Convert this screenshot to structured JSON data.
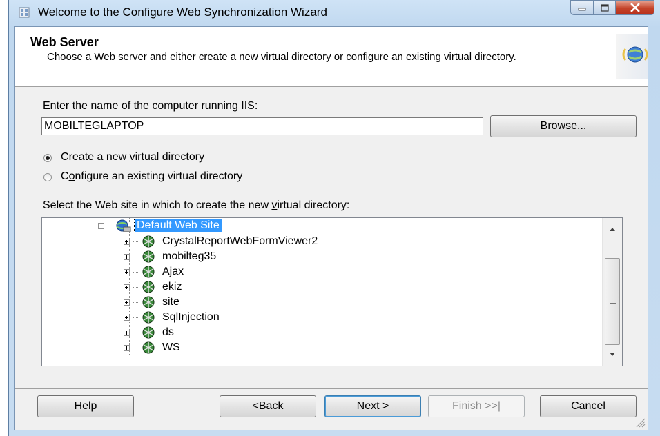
{
  "window": {
    "title": "Welcome to the Configure Web Synchronization Wizard"
  },
  "header": {
    "title": "Web Server",
    "description": "Choose a Web server and either create a new virtual directory or configure an existing virtual directory."
  },
  "computer": {
    "label_pre": "",
    "label_accel": "E",
    "label_post": "nter the name of the computer running IIS:",
    "value": "MOBILTEGLAPTOP",
    "browse_label": "Browse..."
  },
  "options": {
    "create": {
      "accel": "C",
      "rest": "reate a new virtual directory",
      "selected": true
    },
    "configure": {
      "pre": "C",
      "accel": "o",
      "rest": "nfigure an existing virtual directory",
      "selected": false
    }
  },
  "site_select": {
    "label_pre": "Select the Web site in which to create the new ",
    "label_accel": "v",
    "label_post": "irtual directory:"
  },
  "tree": {
    "root": "Default Web Site",
    "children": [
      "CrystalReportWebFormViewer2",
      "mobilteg35",
      "Ajax",
      "ekiz",
      "site",
      "SqlInjection",
      "ds",
      "WS"
    ]
  },
  "buttons": {
    "help": {
      "accel": "H",
      "rest": "elp"
    },
    "back": {
      "pre": "< ",
      "accel": "B",
      "rest": "ack"
    },
    "next": {
      "accel": "N",
      "rest": "ext >"
    },
    "finish": {
      "accel": "F",
      "rest": "inish >>|"
    },
    "cancel": "Cancel"
  },
  "icons": {
    "title": "wizard-icon",
    "header": "globe-sync-icon",
    "tree_root": "website-globe-icon",
    "tree_child": "virtual-directory-icon"
  }
}
